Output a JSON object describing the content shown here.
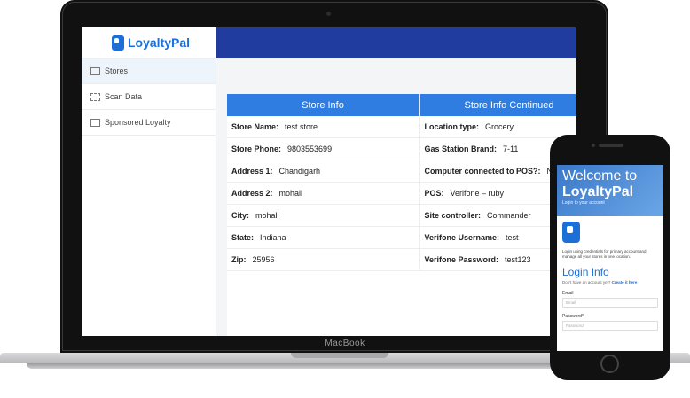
{
  "sidebar": {
    "logo": "LoyaltyPal",
    "items": [
      {
        "label": "Stores"
      },
      {
        "label": "Scan Data"
      },
      {
        "label": "Sponsored Loyalty"
      }
    ]
  },
  "table": {
    "headers": [
      "Store Info",
      "Store Info Continued"
    ],
    "rows": [
      {
        "k1": "Store Name:",
        "v1": "test store",
        "k2": "Location type:",
        "v2": "Grocery"
      },
      {
        "k1": "Store Phone:",
        "v1": "9803553699",
        "k2": "Gas Station Brand:",
        "v2": "7-11"
      },
      {
        "k1": "Address 1:",
        "v1": "Chandigarh",
        "k2": "Computer connected to POS?:",
        "v2": "No"
      },
      {
        "k1": "Address 2:",
        "v1": "mohall",
        "k2": "POS:",
        "v2": "Verifone – ruby"
      },
      {
        "k1": "City:",
        "v1": "mohall",
        "k2": "Site controller:",
        "v2": "Commander"
      },
      {
        "k1": "State:",
        "v1": "Indiana",
        "k2": "Verifone Username:",
        "v2": "test"
      },
      {
        "k1": "Zip:",
        "v1": "25956",
        "k2": "Verifone Password:",
        "v2": "test123"
      }
    ]
  },
  "laptop_brand": "MacBook",
  "phone": {
    "hero_line1": "Welcome to",
    "hero_line2": "LoyaltyPal",
    "hero_sub": "Login to your account",
    "intro": "Login using credentials for primary account and manage all your stores in one location.",
    "heading": "Login Info",
    "no_account": "Don't have an account yet?",
    "create_link": "Create it here",
    "email_label": "Email",
    "email_placeholder": "Email",
    "password_label": "Password*",
    "password_placeholder": "Password"
  },
  "colors": {
    "accent": "#2f7de0",
    "topbar": "#1f3c9e"
  }
}
